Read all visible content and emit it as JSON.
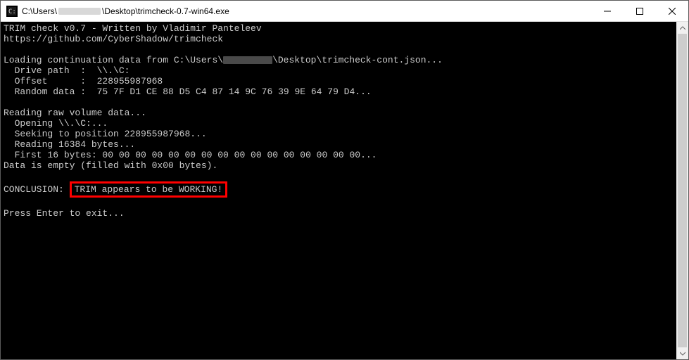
{
  "titlebar": {
    "path_prefix": "C:\\Users\\",
    "path_suffix": "\\Desktop\\trimcheck-0.7-win64.exe"
  },
  "console": {
    "line1": "TRIM check v0.7 - Written by Vladimir Panteleev",
    "line2": "https://github.com/CyberShadow/trimcheck",
    "line3": "",
    "line4_prefix": "Loading continuation data from C:\\Users\\",
    "line4_suffix": "\\Desktop\\trimcheck-cont.json...",
    "line5": "  Drive path  :  \\\\.\\C:",
    "line6": "  Offset      :  228955987968",
    "line7": "  Random data :  75 7F D1 CE 88 D5 C4 87 14 9C 76 39 9E 64 79 D4...",
    "line8": "",
    "line9": "Reading raw volume data...",
    "line10": "  Opening \\\\.\\C:...",
    "line11": "  Seeking to position 228955987968...",
    "line12": "  Reading 16384 bytes...",
    "line13": "  First 16 bytes: 00 00 00 00 00 00 00 00 00 00 00 00 00 00 00 00...",
    "line14": "Data is empty (filled with 0x00 bytes).",
    "line15": "",
    "conclusion_label": "CONCLUSION: ",
    "conclusion_text": "TRIM appears to be WORKING!",
    "line17": "",
    "line18": "Press Enter to exit..."
  }
}
